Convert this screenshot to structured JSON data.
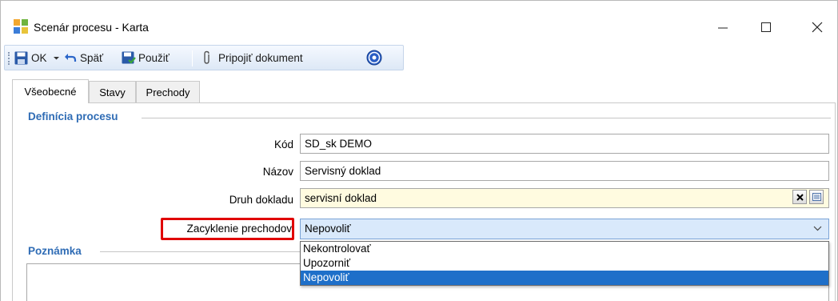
{
  "window": {
    "title": "Scenár procesu - Karta"
  },
  "toolbar": {
    "ok_label": "OK",
    "back_label": "Späť",
    "apply_label": "Použiť",
    "attach_label": "Pripojiť dokument",
    "icons": [
      "save-icon",
      "dropdown-arrow-icon",
      "undo-icon",
      "apply-icon",
      "paperclip-icon",
      "help-icon"
    ]
  },
  "tabs": [
    {
      "label": "Všeobecné",
      "active": true
    },
    {
      "label": "Stavy",
      "active": false
    },
    {
      "label": "Prechody",
      "active": false
    }
  ],
  "definition_group": {
    "title": "Definícia procesu",
    "fields": {
      "kod": {
        "label": "Kód",
        "value": "SD_sk DEMO"
      },
      "nazov": {
        "label": "Názov",
        "value": "Servisný doklad"
      },
      "druh_dokladu": {
        "label": "Druh dokladu",
        "value": "servisní doklad"
      },
      "zacyklenie": {
        "label": "Zacyklenie prechodov",
        "value": "Nepovoliť"
      }
    }
  },
  "dropdown": {
    "options": [
      "Nekontrolovať",
      "Upozorniť",
      "Nepovoliť"
    ],
    "selected": "Nepovoliť"
  },
  "note_group": {
    "title": "Poznámka"
  },
  "colors": {
    "group_title": "#2f6cb5",
    "highlight": "#e00000",
    "selected_option": "#1e6fc9",
    "lookup_field_bg": "#fffbe0",
    "combo_bg": "#d9e9fb"
  }
}
